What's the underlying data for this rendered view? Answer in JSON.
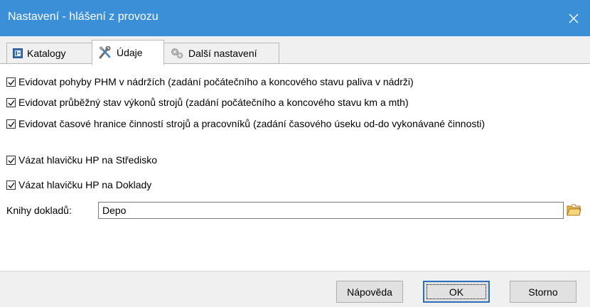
{
  "window": {
    "title": "Nastavení - hlášení z provozu",
    "close_icon": "close-icon"
  },
  "tabs": [
    {
      "label": "Katalogy",
      "icon": "catalog-icon",
      "active": false
    },
    {
      "label": "Údaje",
      "icon": "tools-icon",
      "active": true
    },
    {
      "label": "Další nastavení",
      "icon": "gears-icon",
      "active": false
    }
  ],
  "options": [
    {
      "label": "Evidovat pohyby PHM v nádržích (zadání počátečního a koncového stavu paliva v nádrži)",
      "checked": true
    },
    {
      "label": "Evidovat průběžný stav výkonů strojů (zadání počátečního a koncového stavu km a mth)",
      "checked": true
    },
    {
      "label": "Evidovat časové hranice činností strojů a pracovníků (zadání časového úseku od-do vykonávané činnosti)",
      "checked": true
    },
    {
      "label": "Vázat hlavičku HP na Středisko",
      "checked": true
    },
    {
      "label": "Vázat hlavičku HP na Doklady",
      "checked": true
    }
  ],
  "books": {
    "label": "Knihy dokladů:",
    "value": "Depo",
    "browse_icon": "folder-icon"
  },
  "footer": {
    "help_label": "Nápověda",
    "ok_label": "OK",
    "cancel_label": "Storno"
  },
  "colors": {
    "titlebar": "#3b8fd6",
    "default_button_border": "#2a6fb8"
  }
}
